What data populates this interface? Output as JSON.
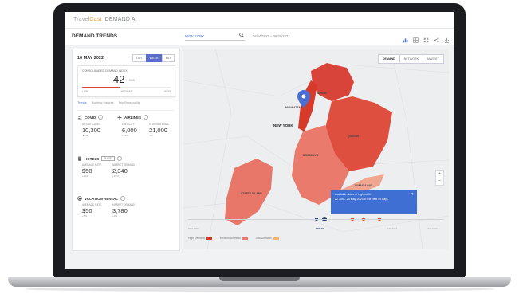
{
  "app": {
    "brand_name": "TravelCast",
    "brand_accent": "Cast",
    "brand_prefix": "Travel",
    "product": "DEMAND AI"
  },
  "toolbar": {
    "title": "DEMAND TRENDS",
    "search_value": "NEW YORK",
    "date_range": "06/16/2022 – 06/30/2022"
  },
  "left_panel": {
    "date": "16 MAY 2022",
    "range_tabs": [
      "DAY",
      "WEEK",
      "MO"
    ],
    "active_range": "WEEK",
    "gauge": {
      "label": "CONSOLIDATED DEMAND INDEX",
      "value": "42",
      "unit": "/100",
      "level": 0.42,
      "ticks": [
        "LOW",
        "MEDIUM",
        "HIGH"
      ]
    },
    "tabs": [
      "Trends",
      "Booking Insights",
      "Trip Seasonality"
    ],
    "active_tab": "Trends",
    "covid": {
      "title": "COVID",
      "stats": [
        {
          "label": "ACTIVE CASES",
          "value": "10,300",
          "sub": "▲5%"
        }
      ]
    },
    "airlines": {
      "title": "AIRLINES",
      "stats": [
        {
          "label": "CAPACITY",
          "value": "6,000",
          "sub": "+10%"
        },
        {
          "label": "INTERNATIONAL",
          "value": "21,000",
          "sub": "-8%"
        }
      ]
    },
    "hotels": {
      "title": "HOTELS",
      "badge": "GUEST",
      "stats": [
        {
          "label": "AVERAGE RATE",
          "value": "$50",
          "sub": "+10%"
        },
        {
          "label": "MARKET DEMAND",
          "value": "2,340",
          "sub": "+15%"
        }
      ]
    },
    "vacation_rental": {
      "title": "VACATION RENTAL",
      "stats": [
        {
          "label": "AVERAGE RATE",
          "value": "$50",
          "sub": "+5%"
        },
        {
          "label": "MARKET DEMAND",
          "value": "3,780",
          "sub": "+2%"
        }
      ]
    }
  },
  "map": {
    "view_toggle": [
      "DEMAND",
      "NETWORK",
      "MARKET"
    ],
    "active_view": "DEMAND",
    "labels": {
      "new_york": "NEW YORK",
      "manhattan": "MANHATTAN",
      "bronx": "BRONX",
      "queens": "QUEENS",
      "brooklyn": "BROOKLYN",
      "staten_island": "STATEN ISLAND",
      "jamaica_bay": "JAMAICA BAY"
    },
    "tooltip": {
      "line1": "Available dates of highest fit:",
      "line2": "22 Jun – 24 May 2023 in the next 90 days"
    },
    "timeline_labels": [
      "MAY 2022",
      "TODAY",
      "JUN 2022",
      "JUL 2022"
    ],
    "legend": [
      {
        "label": "High Demand",
        "color": "#d63a2a"
      },
      {
        "label": "Medium Demand",
        "color": "#ea7a6b"
      },
      {
        "label": "Low Demand",
        "color": "#f2b36b"
      }
    ],
    "zoom": [
      "+",
      "–"
    ]
  },
  "colors": {
    "accent_blue": "#4a6fd4",
    "high": "#d63a2a",
    "medium": "#e8776a",
    "low": "#f0a58f"
  }
}
